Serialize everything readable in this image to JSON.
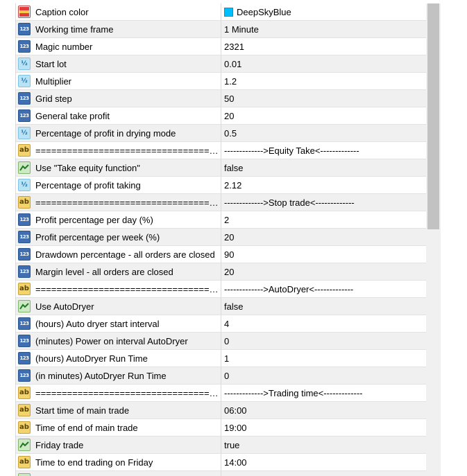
{
  "colors": {
    "caption_swatch": "#00BFFF",
    "accent_number_icon": "#3f6fb0"
  },
  "rows": [
    {
      "type": "color",
      "name": "Caption color",
      "value": "DeepSkyBlue"
    },
    {
      "type": "int",
      "name": "Working time frame",
      "value": "1 Minute"
    },
    {
      "type": "int",
      "name": "Magic number",
      "value": "2321"
    },
    {
      "type": "double",
      "name": "Start lot",
      "value": "0.01"
    },
    {
      "type": "double",
      "name": "Multiplier",
      "value": "1.2"
    },
    {
      "type": "int",
      "name": "Grid step",
      "value": "50"
    },
    {
      "type": "int",
      "name": "General take profit",
      "value": "20"
    },
    {
      "type": "double",
      "name": "Percentage of profit in drying mode",
      "value": "0.5"
    },
    {
      "type": "string",
      "name": "=====================================",
      "value": "------------->Equity Take<-------------"
    },
    {
      "type": "bool",
      "name": "Use \"Take equity function\"",
      "value": "false"
    },
    {
      "type": "double",
      "name": "Percentage of profit taking",
      "value": "2.12"
    },
    {
      "type": "string",
      "name": "=====================================",
      "value": "------------->Stop trade<-------------"
    },
    {
      "type": "int",
      "name": "Profit percentage per day (%)",
      "value": "2"
    },
    {
      "type": "int",
      "name": "Profit percentage per week (%)",
      "value": "20"
    },
    {
      "type": "int",
      "name": "Drawdown percentage - all orders are closed",
      "value": "90"
    },
    {
      "type": "int",
      "name": "Margin level - all orders are closed",
      "value": "20"
    },
    {
      "type": "string",
      "name": "=====================================",
      "value": "------------->AutoDryer<-------------"
    },
    {
      "type": "bool",
      "name": "Use AutoDryer",
      "value": "false"
    },
    {
      "type": "int",
      "name": "(hours) Auto dryer start interval",
      "value": "4"
    },
    {
      "type": "int",
      "name": "(minutes) Power on interval AutoDryer",
      "value": "0"
    },
    {
      "type": "int",
      "name": "(hours) AutoDryer Run Time",
      "value": "1"
    },
    {
      "type": "int",
      "name": "(in minutes) AutoDryer Run Time",
      "value": "0"
    },
    {
      "type": "string",
      "name": "=====================================",
      "value": "------------->Trading time<-------------"
    },
    {
      "type": "string",
      "name": "Start time of main trade",
      "value": "06:00"
    },
    {
      "type": "string",
      "name": "Time of end of main trade",
      "value": "19:00"
    },
    {
      "type": "bool",
      "name": "Friday trade",
      "value": "true"
    },
    {
      "type": "string",
      "name": "Time to end trading on Friday",
      "value": "14:00"
    },
    {
      "type": "bool",
      "name": "",
      "value": ""
    }
  ],
  "icons": {
    "int": {
      "glyph": "123",
      "name": "integer-param-icon"
    },
    "double": {
      "glyph": "½",
      "name": "double-param-icon"
    },
    "string": {
      "glyph": "ab",
      "name": "string-param-icon"
    },
    "bool": {
      "glyph": "",
      "name": "bool-param-icon"
    },
    "color": {
      "glyph": "",
      "name": "color-param-icon"
    }
  }
}
